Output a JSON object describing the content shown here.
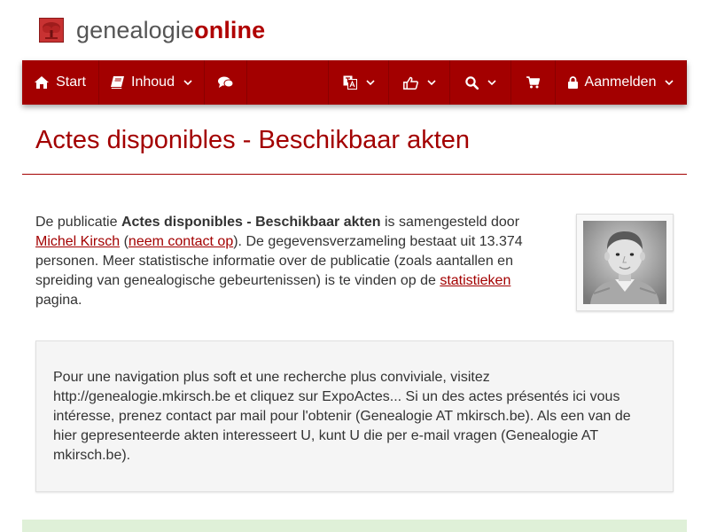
{
  "brand": {
    "part1": "genealogie",
    "part2": "online",
    "accent_color": "#a30000",
    "icon": "tree-icon"
  },
  "nav": {
    "start": {
      "label": "Start",
      "icon": "home-icon"
    },
    "inhoud": {
      "label": "Inhoud",
      "icon": "book-icon"
    },
    "chat": {
      "icon": "comments-icon"
    },
    "language": {
      "icon": "translate-icon"
    },
    "social": {
      "icon": "thumbs-up-icon"
    },
    "search": {
      "icon": "search-icon"
    },
    "shop": {
      "icon": "cart-icon"
    },
    "login": {
      "label": "Aanmelden",
      "icon": "lock-icon"
    }
  },
  "page": {
    "title": "Actes disponibles - Beschikbaar akten"
  },
  "intro": {
    "text1": "De publicatie ",
    "pub_name": "Actes disponibles - Beschikbaar akten",
    "text2": " is samengesteld door ",
    "author": "Michel Kirsch",
    "text3": " (",
    "contact": "neem contact op",
    "text4": "). De gegevensverzameling bestaat uit 13.374 personen. Meer statistische informatie over de publicatie (zoals aantallen en spreiding van genealogische gebeurtenissen) is te vinden op de ",
    "stats_link": "statistieken",
    "text5": " pagina."
  },
  "description": "Pour une navigation plus soft et une recherche plus conviviale, visitez http://genealogie.mkirsch.be et cliquez sur ExpoActes... Si un des actes présentés ici vous intéresse, prenez contact par mail pour l'obtenir (Genealogie AT mkirsch.be). Als een van de hier gepresenteerde akten interesseert U, kunt U die per e-mail vragen (Genealogie AT mkirsch.be)."
}
